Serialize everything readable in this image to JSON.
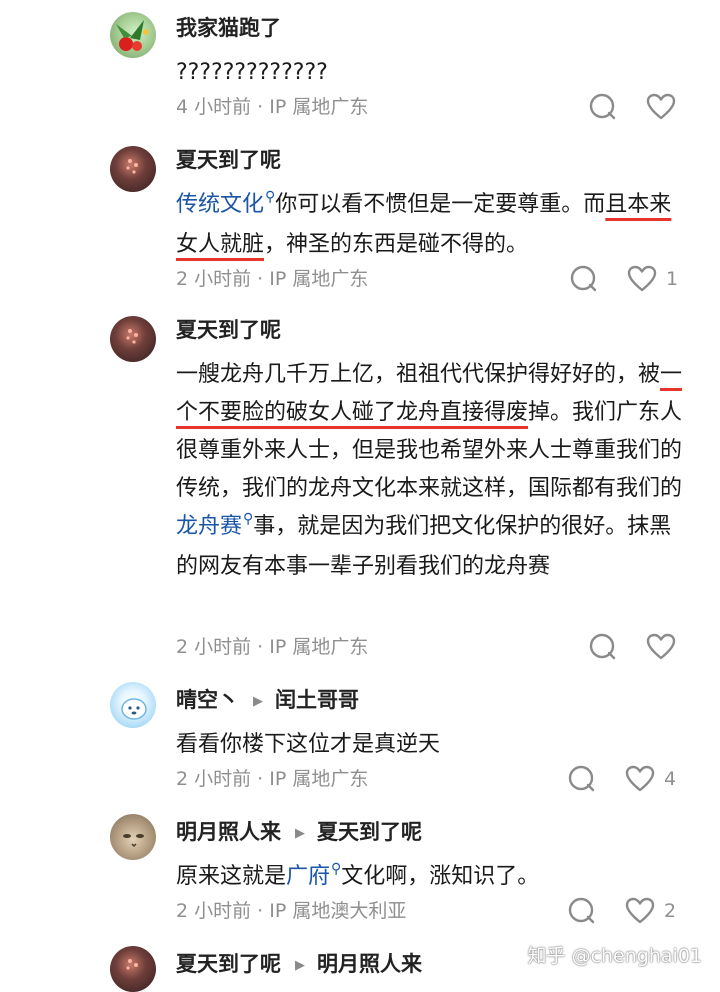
{
  "comments": [
    {
      "author": "我家猫跑了",
      "text": "?????????????",
      "meta": "4 小时前 · IP 属地广东",
      "likes": ""
    },
    {
      "author": "夏天到了呢",
      "link": "传统文化",
      "text_a": "你可以看不惯但是一定要尊重。而",
      "text_u": "且本来女人就脏",
      "text_b": "，神圣的东西是碰不得的。",
      "meta": "2 小时前 · IP 属地广东",
      "likes": "1"
    },
    {
      "author": "夏天到了呢",
      "text_a": "一艘龙舟几千万上亿，祖祖代代保护得好好的，被",
      "text_u": "一个不要脸的破女人碰了龙舟直接得废",
      "text_b": "掉。我们广东人很尊重外来人士，但是我也希望外来人士尊重我们的传统，我们的龙舟文化本来就这样，国际都有我们的",
      "link": "龙舟赛",
      "text_c": "事，就是因为我们把文化保护的很好。抹黑的网友有本事一辈子别看我们的龙舟赛",
      "meta": "2 小时前 · IP 属地广东",
      "likes": ""
    },
    {
      "author": "晴空丶",
      "reply_to": "闰土哥哥",
      "text": "看看你楼下这位才是真逆天",
      "meta": "2 小时前 · IP 属地广东",
      "likes": "4"
    },
    {
      "author": "明月照人来",
      "reply_to": "夏天到了呢",
      "text_a": "原来这就是",
      "link": "广府",
      "text_b": "文化啊，涨知识了。",
      "meta": "2 小时前 · IP 属地澳大利亚",
      "likes": "2"
    },
    {
      "author": "夏天到了呢",
      "reply_to": "明月照人来"
    }
  ],
  "watermark": "知乎 @chenghai01",
  "icons": {
    "reply": "comment-bubble-icon",
    "like": "heart-icon",
    "reply_arrow": "reply-arrow-icon",
    "search": "search-icon"
  },
  "colors": {
    "link": "#1a55a8",
    "underline": "#e8352c",
    "meta": "#8f8f8f"
  }
}
